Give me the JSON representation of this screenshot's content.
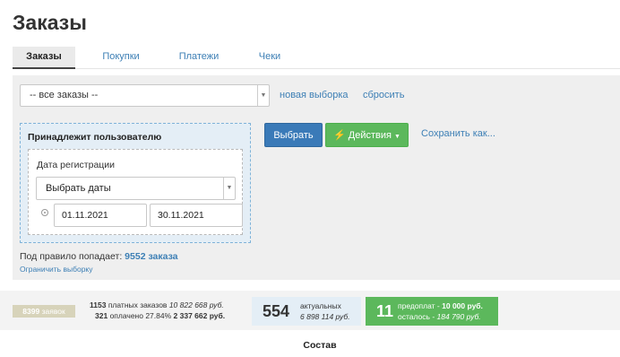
{
  "page": {
    "title": "Заказы"
  },
  "tabs": [
    {
      "label": "Заказы",
      "active": true
    },
    {
      "label": "Покупки",
      "active": false
    },
    {
      "label": "Платежи",
      "active": false
    },
    {
      "label": "Чеки",
      "active": false
    }
  ],
  "filter": {
    "select_value": "-- все заказы --",
    "new_selection": "новая выборка",
    "reset": "сбросить"
  },
  "rule": {
    "title": "Принадлежит пользователю",
    "field_label": "Дата регистрации",
    "date_select": "Выбрать даты",
    "date_from": "01.11.2021",
    "date_to": "30.11.2021"
  },
  "actions": {
    "select_button": "Выбрать",
    "actions_button": "Действия",
    "save_as": "Сохранить как..."
  },
  "summary": {
    "prefix": "Под правило попадает:",
    "count": "9552 заказа",
    "limit_link": "Ограничить выборку"
  },
  "stats": {
    "requests_count": "8399",
    "requests_label": "заявок",
    "paid_orders_count": "1153",
    "paid_orders_label": "платных заказов",
    "paid_orders_sum": "10 822 668 руб.",
    "paid_count": "321",
    "paid_label": "оплачено 27.84%",
    "paid_sum": "2 337 662 руб.",
    "actual_count": "554",
    "actual_label": "актуальных",
    "actual_sum": "6 898 114 руб.",
    "prepay_count": "11",
    "prepay_label": "предоплат -",
    "prepay_sum": "10 000 руб.",
    "remaining_label": "осталось -",
    "remaining_sum": "184 790 руб.",
    "colors": {
      "green": "#5cb85c",
      "blue": "#3a7ab8",
      "gray_badge": "#d7d3ba"
    }
  },
  "section": {
    "title": "Состав"
  }
}
